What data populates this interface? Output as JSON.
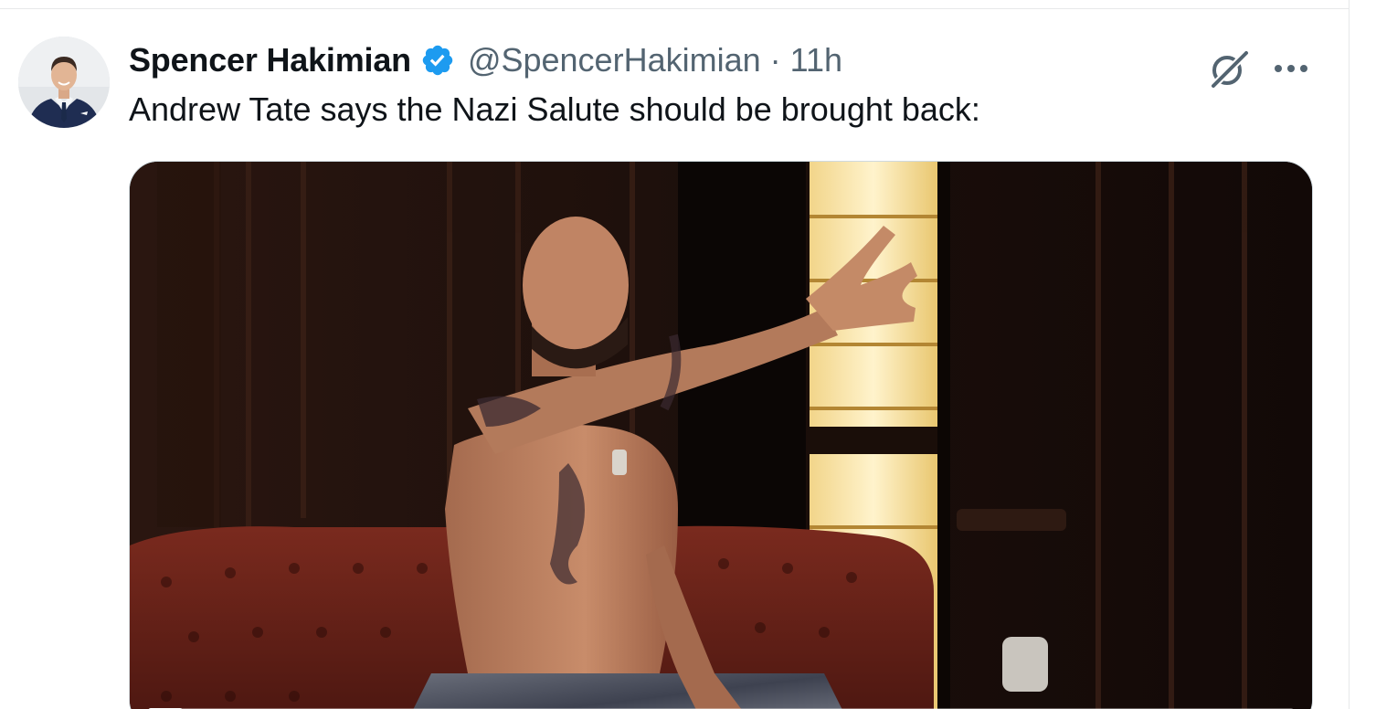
{
  "tweet": {
    "author": {
      "display_name": "Spencer Hakimian",
      "handle": "@SpencerHakimian",
      "verified": true,
      "avatar_icon": "profile-photo"
    },
    "separator": "·",
    "timestamp": "11h",
    "text": "Andrew Tate says the Nazi Salute should be brought back:",
    "actions": {
      "grok_icon": "grok-icon",
      "more_icon": "more-options-icon"
    },
    "media": {
      "type": "video",
      "progress": 0.03
    }
  },
  "colors": {
    "text_primary": "#0f1419",
    "text_secondary": "#536471",
    "verified_blue": "#1d9bf0",
    "divider": "#e7e9ea"
  }
}
